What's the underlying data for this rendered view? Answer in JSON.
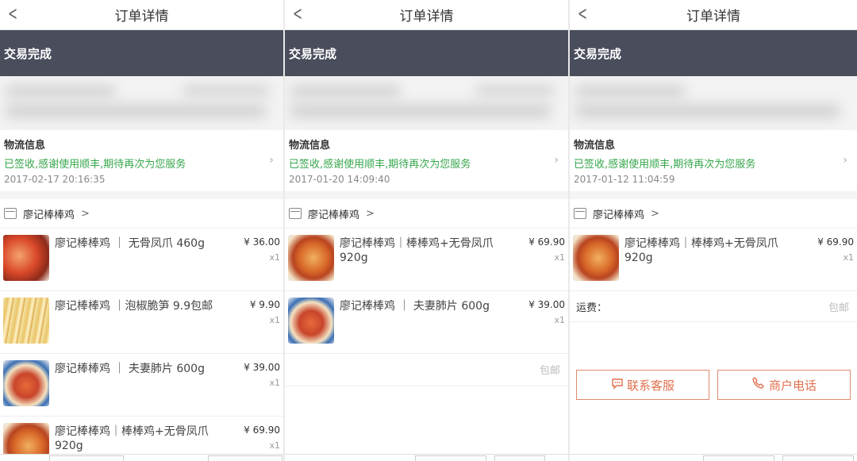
{
  "screens": [
    {
      "nav_title": "订单详情",
      "status": "交易完成",
      "logistics": {
        "title": "物流信息",
        "message": "已签收,感谢使用顺丰,期待再次为您服务",
        "time": "2017-02-17 20:16:35"
      },
      "shop_name": "廖记棒棒鸡",
      "items": [
        {
          "name": "廖记棒棒鸡 ｜ 无骨凤爪 460g",
          "price": "¥ 36.00",
          "qty": "x1"
        },
        {
          "name": "廖记棒棒鸡 ｜泡椒脆笋 9.9包邮",
          "price": "¥ 9.90",
          "qty": "x1"
        },
        {
          "name": "廖记棒棒鸡 ｜ 夫妻肺片 600g",
          "price": "¥ 39.00",
          "qty": "x1"
        },
        {
          "name": "廖记棒棒鸡｜棒棒鸡+无骨凤爪 920g",
          "price": "¥ 69.90",
          "qty": "x1"
        }
      ]
    },
    {
      "nav_title": "订单详情",
      "status": "交易完成",
      "logistics": {
        "title": "物流信息",
        "message": "已签收,感谢使用顺丰,期待再次为您服务",
        "time": "2017-01-20 14:09:40"
      },
      "shop_name": "廖记棒棒鸡",
      "items": [
        {
          "name": "廖记棒棒鸡｜棒棒鸡+无骨凤爪 920g",
          "price": "¥ 69.90",
          "qty": "x1"
        },
        {
          "name": "廖记棒棒鸡 ｜ 夫妻肺片 600g",
          "price": "¥ 39.00",
          "qty": "x1"
        }
      ],
      "shipping_value": "包邮"
    },
    {
      "nav_title": "订单详情",
      "status": "交易完成",
      "logistics": {
        "title": "物流信息",
        "message": "已签收,感谢使用顺丰,期待再次为您服务",
        "time": "2017-01-12 11:04:59"
      },
      "shop_name": "廖记棒棒鸡",
      "items": [
        {
          "name": "廖记棒棒鸡｜棒棒鸡+无骨凤爪 920g",
          "price": "¥ 69.90",
          "qty": "x1"
        }
      ],
      "shipping_label": "运费：",
      "shipping_value": "包邮",
      "buttons": {
        "contact": "联系客服",
        "phone": "商户电话"
      }
    }
  ],
  "icons": [
    "back-chevron-icon",
    "shop-icon",
    "chevron-right-icon",
    "chat-bubble-icon",
    "phone-icon"
  ],
  "colors": {
    "status_bar": "#4a4d5c",
    "logistics_green": "#36a64b",
    "button_accent": "#e0704e"
  }
}
